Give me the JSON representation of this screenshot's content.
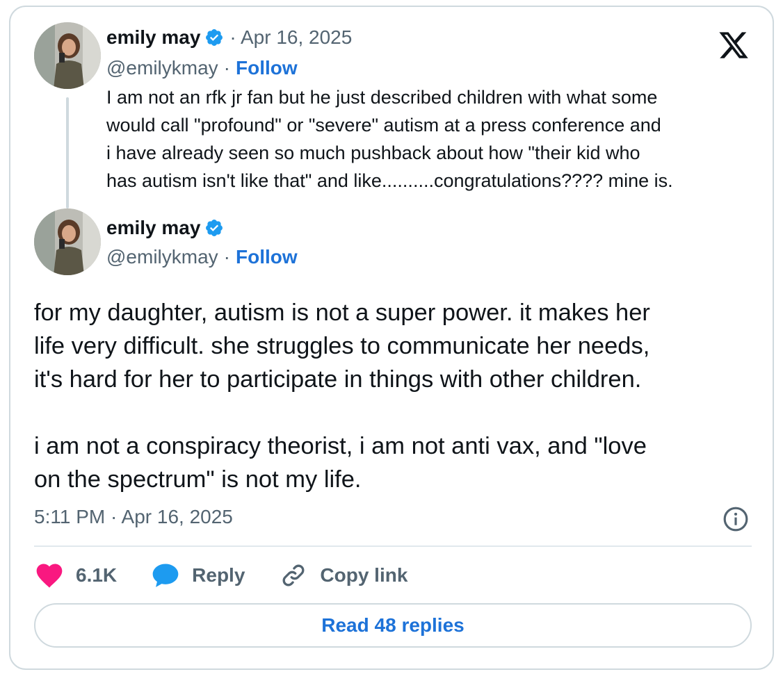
{
  "quoted_tweet": {
    "author_name": "emily may",
    "date": "· Apr 16, 2025",
    "handle": "@emilykmay",
    "separator": "·",
    "follow_label": "Follow",
    "text": "I am not an rfk jr fan but he just described children with what some\nwould call \"profound\" or \"severe\" autism at a press conference and\ni have already seen so much pushback about how \"their kid who\nhas autism isn't like that\" and like..........congratulations???? mine is."
  },
  "main_tweet": {
    "author_name": "emily may",
    "handle": "@emilykmay",
    "separator": "·",
    "follow_label": "Follow",
    "text": "for my daughter, autism is not a super power. it makes her\nlife very difficult. she struggles to communicate her needs,\nit's hard for her to participate in things with other children.\n\ni am not a conspiracy theorist, i am not anti vax, and \"love\non the spectrum\" is not my life.",
    "timestamp": "5:11 PM · Apr 16, 2025"
  },
  "actions": {
    "like_count": "6.1K",
    "reply_label": "Reply",
    "copy_link_label": "Copy link"
  },
  "read_replies_label": "Read 48 replies",
  "icons": {
    "brand": "x-logo-icon",
    "verified": "verified-badge-icon",
    "like": "heart-icon",
    "reply": "speech-bubble-icon",
    "copy": "link-icon",
    "info": "info-icon"
  },
  "colors": {
    "accent": "#1d72d8",
    "verified": "#1d9bf0",
    "like": "#f91880",
    "muted": "#536471",
    "border": "#cfd9de"
  }
}
